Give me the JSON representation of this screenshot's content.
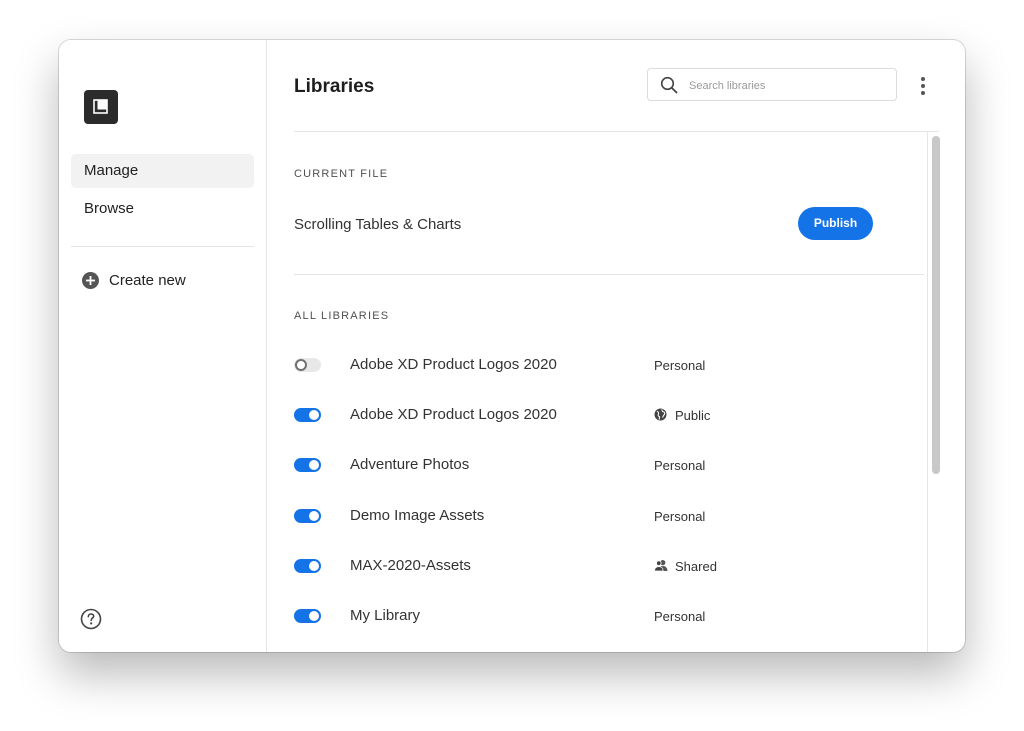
{
  "sidebar": {
    "nav": [
      {
        "label": "Manage",
        "active": true
      },
      {
        "label": "Browse",
        "active": false
      }
    ],
    "create_new": "Create new",
    "icons": {
      "logo": "libraries-logo-icon",
      "add": "plus-circle-icon",
      "help": "help-circle-icon"
    }
  },
  "header": {
    "title": "Libraries",
    "search_placeholder": "Search libraries"
  },
  "current_file": {
    "section_label": "CURRENT FILE",
    "file_name": "Scrolling Tables & Charts",
    "publish_label": "Publish"
  },
  "all_libraries": {
    "section_label": "ALL LIBRARIES",
    "items": [
      {
        "name": "Adobe XD Product Logos 2020",
        "status": "Personal",
        "enabled": false,
        "status_icon": ""
      },
      {
        "name": "Adobe XD Product Logos 2020",
        "status": "Public",
        "enabled": true,
        "status_icon": "globe-icon"
      },
      {
        "name": "Adventure Photos",
        "status": "Personal",
        "enabled": true,
        "status_icon": ""
      },
      {
        "name": "Demo Image Assets",
        "status": "Personal",
        "enabled": true,
        "status_icon": ""
      },
      {
        "name": "MAX-2020-Assets",
        "status": "Shared",
        "enabled": true,
        "status_icon": "users-icon"
      },
      {
        "name": "My Library",
        "status": "Personal",
        "enabled": true,
        "status_icon": ""
      }
    ]
  },
  "colors": {
    "accent": "#1473e6",
    "close": "#ee5d55"
  }
}
